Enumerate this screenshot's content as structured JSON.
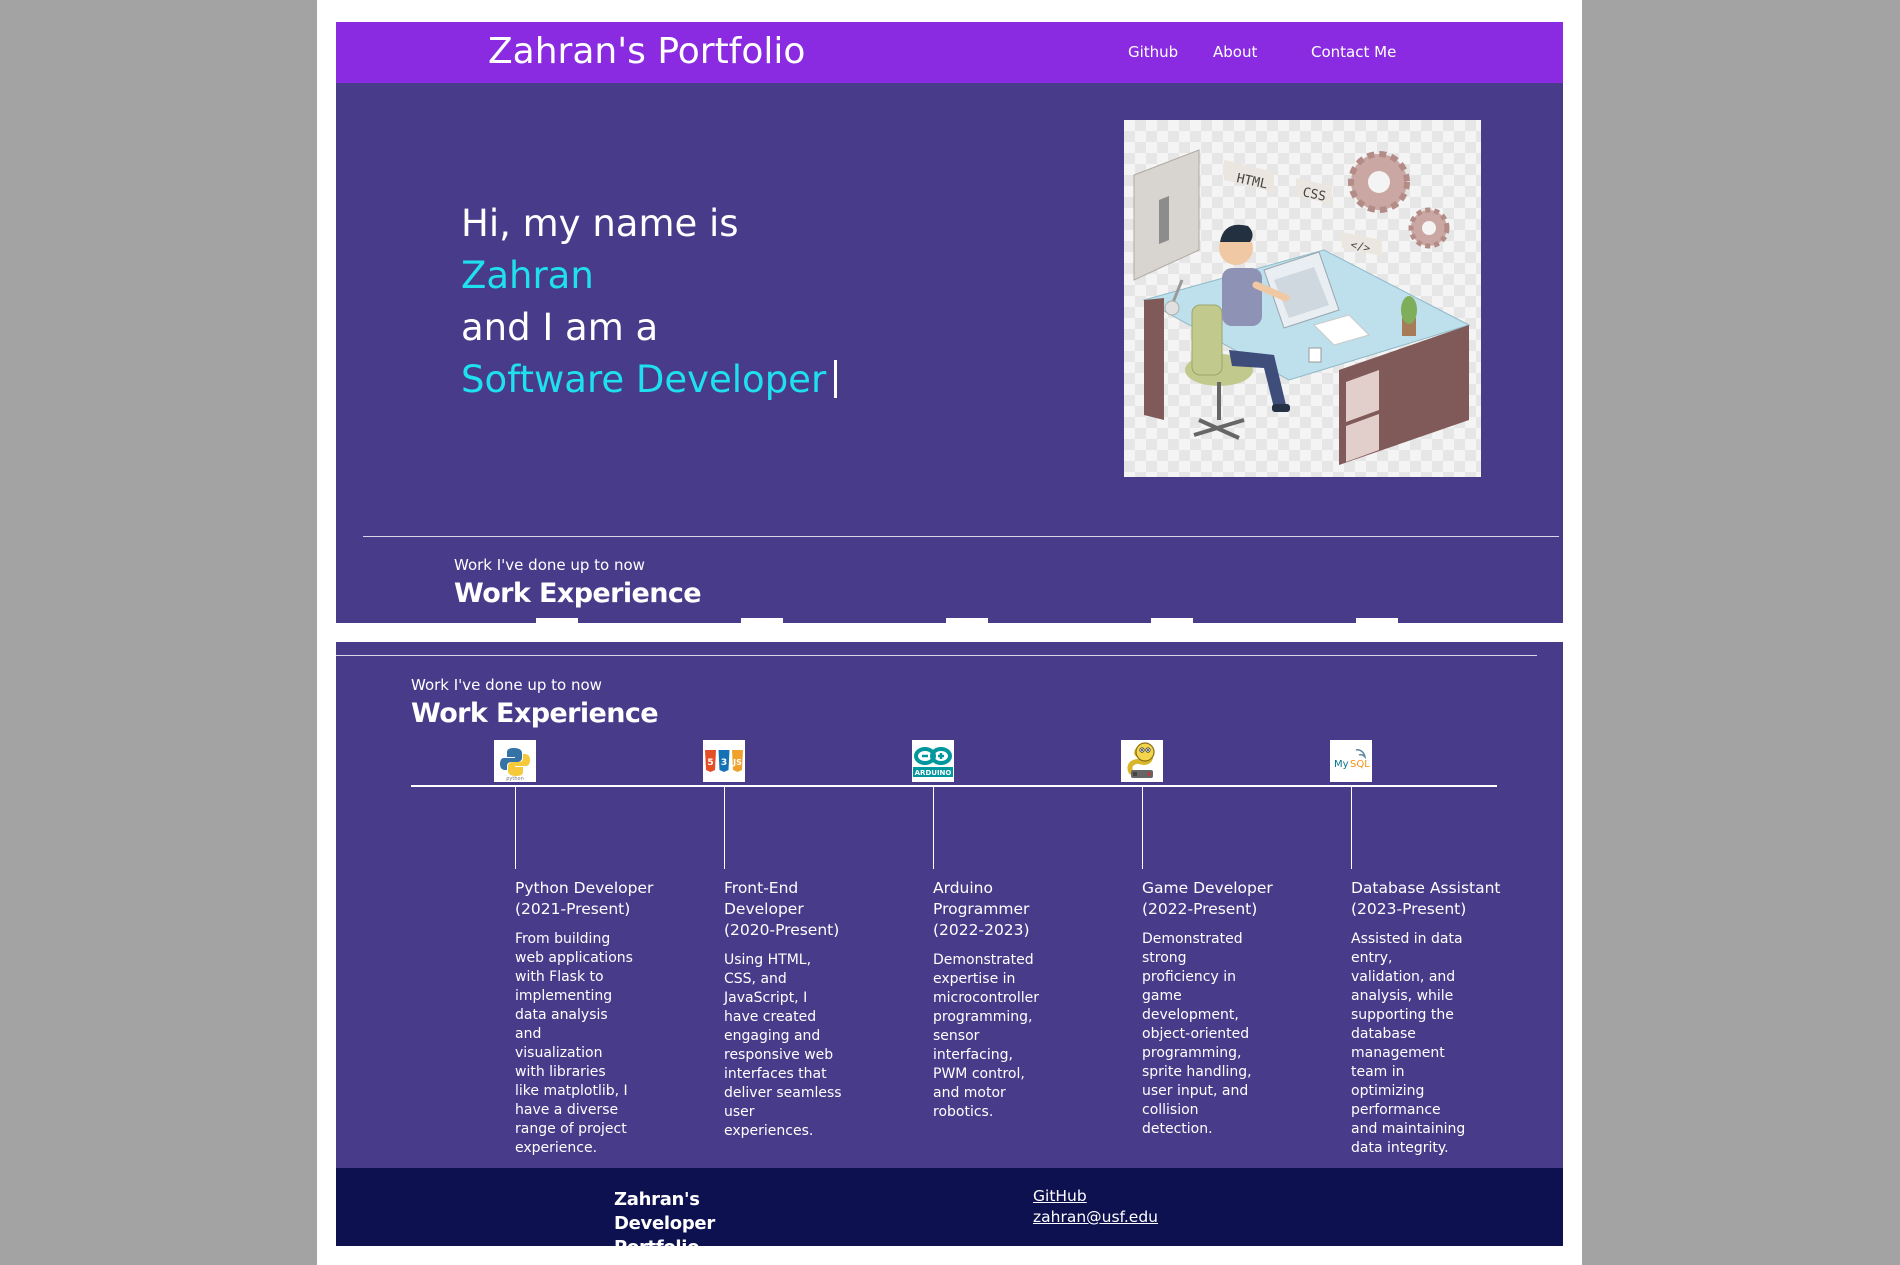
{
  "hero_section": {
    "navbar": {
      "brand": "Zahran's Portfolio",
      "links": [
        "Github",
        "About",
        "Contact Me"
      ]
    },
    "greeting_line1": "Hi, my name is",
    "name": "Zahran",
    "greeting_line3": "and I am a",
    "role": "Software Developer",
    "image_labels": [
      "HTML",
      "CSS",
      "</>"
    ],
    "subtitle": "Work I've done up to now",
    "heading": "Work Experience"
  },
  "experience_section": {
    "subtitle": "Work I've done up to now",
    "heading": "Work Experience",
    "items": [
      {
        "icon": "python-logo-icon",
        "title": "Python Developer (2021-Present)",
        "description": "From building web applications with Flask to implementing data analysis and visualization with libraries like matplotlib, I have a diverse range of project experience."
      },
      {
        "icon": "html-css-js-logo-icon",
        "title": "Front-End Developer (2020-Present)",
        "description": "Using HTML, CSS, and JavaScript, I have created engaging and responsive web interfaces that deliver seamless user experiences."
      },
      {
        "icon": "arduino-logo-icon",
        "title": "Arduino Programmer (2022-2023)",
        "description": "Demonstrated expertise in microcontroller programming, sensor interfacing, PWM control, and motor robotics."
      },
      {
        "icon": "pygame-snake-logo-icon",
        "title": "Game Developer (2022-Present)",
        "description": "Demonstrated strong proficiency in game development, object-oriented programming, sprite handling, user input, and collision detection."
      },
      {
        "icon": "mysql-logo-icon",
        "title": "Database Assistant (2023-Present)",
        "description": "Assisted in data entry, validation, and analysis, while supporting the database management team in optimizing performance and maintaining data integrity."
      }
    ]
  },
  "footer": {
    "brand": "Zahran's Developer Portfolio",
    "github_link": "GitHub",
    "email_link": "zahran@usf.edu"
  },
  "colors": {
    "navbar": "#8a2be2",
    "background": "#483c8a",
    "accent_text": "#1ee0ef",
    "footer": "#0e1150"
  }
}
